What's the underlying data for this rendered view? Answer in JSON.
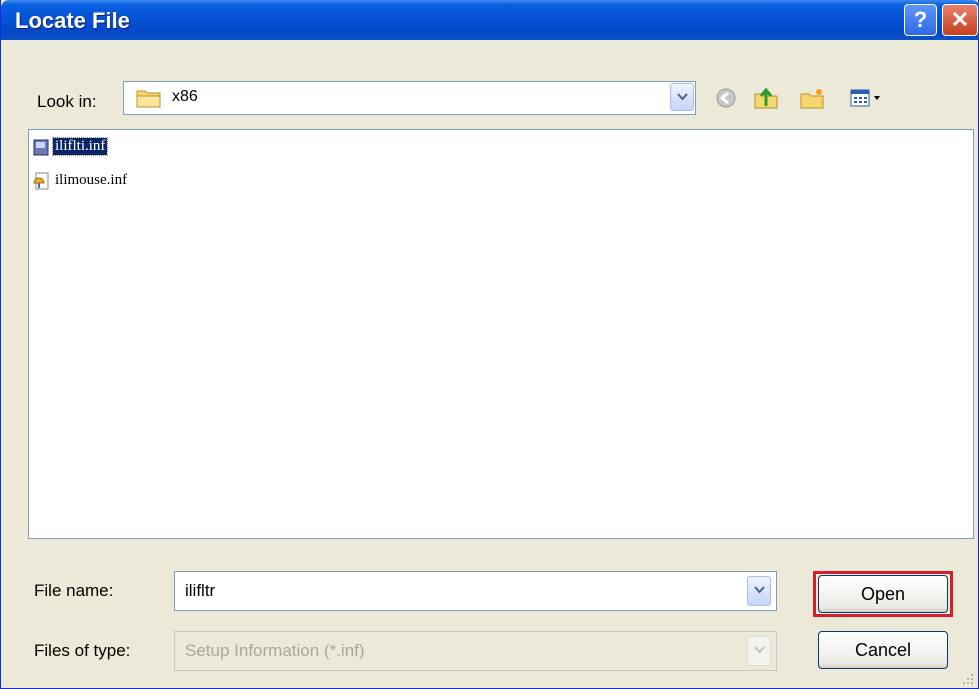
{
  "window": {
    "title": "Locate File"
  },
  "titlebar": {
    "help_glyph": "?",
    "close_glyph": "✕"
  },
  "lookin": {
    "label": "Look in:",
    "value": "x86"
  },
  "toolbar": {
    "icons": [
      "back-icon",
      "up-folder-icon",
      "new-folder-icon",
      "view-menu-icon"
    ]
  },
  "files": [
    {
      "name": "iliflti.inf",
      "selected": true,
      "icon": "inf-file-icon"
    },
    {
      "name": "ilimouse.inf",
      "selected": false,
      "icon": "setup-file-icon"
    }
  ],
  "filename": {
    "label": "File name:",
    "value": "ilifltr"
  },
  "filetype": {
    "label": "Files of type:",
    "value": "Setup Information (*.inf)"
  },
  "buttons": {
    "open": "Open",
    "cancel": "Cancel"
  },
  "colors": {
    "titlebar": "#0553d6",
    "selection": "#0a246a",
    "highlight": "#d4202a",
    "dialog_bg": "#ece9d8"
  }
}
